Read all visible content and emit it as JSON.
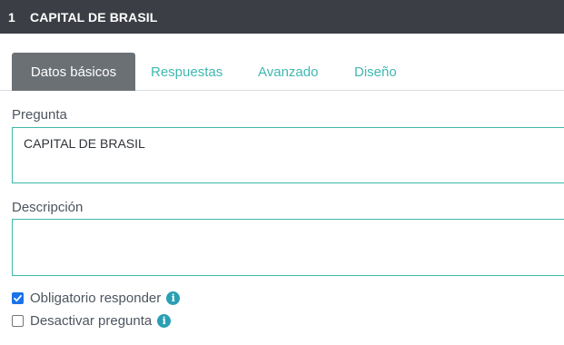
{
  "header": {
    "number": "1",
    "title": "CAPITAL DE BRASIL"
  },
  "tabs": [
    {
      "label": "Datos básicos",
      "active": true
    },
    {
      "label": "Respuestas",
      "active": false
    },
    {
      "label": "Avanzado",
      "active": false
    },
    {
      "label": "Diseño",
      "active": false
    }
  ],
  "form": {
    "question_label": "Pregunta",
    "question_value": "CAPITAL DE BRASIL",
    "description_label": "Descripción",
    "description_value": ""
  },
  "options": [
    {
      "label": "Obligatorio responder",
      "checked": true,
      "icon": "info-icon"
    },
    {
      "label": "Desactivar pregunta",
      "checked": false,
      "icon": "info-icon"
    }
  ],
  "colors": {
    "header_bg": "#3b3e44",
    "active_tab_bg": "#6b7075",
    "accent": "#3fb8b0",
    "info_icon": "#2a9fb3",
    "checkbox_checked": "#1a73e8"
  }
}
